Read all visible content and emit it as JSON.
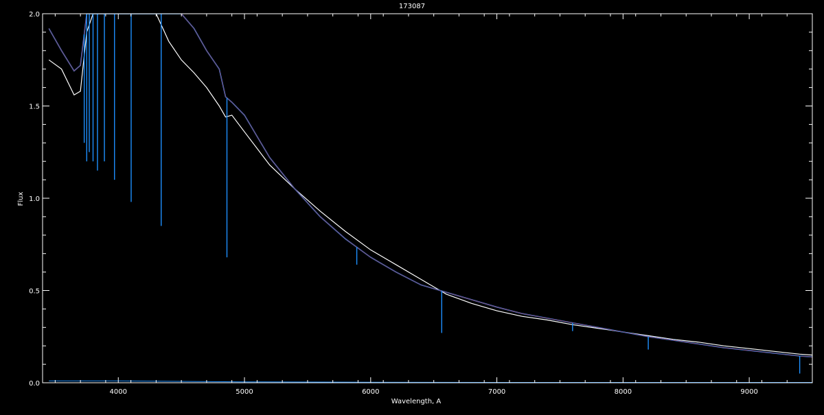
{
  "chart_data": {
    "type": "line",
    "title": "173087",
    "xlabel": "Wavelength, A",
    "ylabel": "Flux",
    "xlim": [
      3400,
      9500
    ],
    "ylim": [
      0,
      2
    ],
    "xticks": [
      4000,
      5000,
      6000,
      7000,
      8000,
      9000
    ],
    "yticks": [
      0.0,
      0.5,
      1.0,
      1.5,
      2.0
    ],
    "ytick_labels": [
      "0.0",
      "0.5",
      "1.0",
      "1.5",
      "2.0"
    ],
    "grid": false,
    "legend": "none",
    "colors": {
      "background": "#000000",
      "axes": "#ffffff",
      "observed": "#ffffff",
      "model": "#1e90ff",
      "fit": "#cc2020"
    },
    "series": [
      {
        "color_key": "observed",
        "x": [
          3450,
          3550,
          3650,
          3700,
          3750,
          3800,
          3900,
          4000,
          4100,
          4200,
          4300,
          4400,
          4500,
          4600,
          4700,
          4800,
          4850,
          4900,
          5000,
          5200,
          5400,
          5600,
          5800,
          6000,
          6200,
          6400,
          6600,
          6800,
          7000,
          7200,
          7400,
          7600,
          7800,
          8000,
          8200,
          8400,
          8600,
          8800,
          9000,
          9200,
          9400,
          9500
        ],
        "y": [
          1.75,
          1.7,
          1.56,
          1.58,
          1.9,
          2.0,
          2.0,
          2.0,
          2.0,
          2.0,
          2.0,
          1.85,
          1.75,
          1.68,
          1.6,
          1.5,
          1.44,
          1.45,
          1.36,
          1.18,
          1.05,
          0.93,
          0.82,
          0.72,
          0.64,
          0.56,
          0.48,
          0.43,
          0.39,
          0.36,
          0.34,
          0.315,
          0.295,
          0.275,
          0.255,
          0.235,
          0.22,
          0.2,
          0.185,
          0.17,
          0.155,
          0.15
        ]
      },
      {
        "color_key": "model",
        "x": [
          3450,
          3550,
          3650,
          3700,
          3750,
          3800,
          3900,
          4000,
          4100,
          4200,
          4300,
          4400,
          4500,
          4600,
          4700,
          4800,
          4850,
          4900,
          5000,
          5200,
          5400,
          5600,
          5800,
          6000,
          6200,
          6400,
          6600,
          6800,
          7000,
          7200,
          7400,
          7600,
          7800,
          8000,
          8200,
          8400,
          8600,
          8800,
          9000,
          9200,
          9400,
          9500
        ],
        "y": [
          1.92,
          1.8,
          1.69,
          1.72,
          2.0,
          2.0,
          2.0,
          2.0,
          2.0,
          2.0,
          2.0,
          2.0,
          2.0,
          1.92,
          1.8,
          1.7,
          1.55,
          1.52,
          1.45,
          1.22,
          1.05,
          0.9,
          0.78,
          0.68,
          0.6,
          0.53,
          0.49,
          0.45,
          0.41,
          0.375,
          0.35,
          0.325,
          0.3,
          0.275,
          0.25,
          0.23,
          0.21,
          0.19,
          0.175,
          0.16,
          0.145,
          0.14
        ]
      }
    ],
    "absorption_lines": [
      {
        "x": 3730,
        "depth_to": 1.3
      },
      {
        "x": 3750,
        "depth_to": 1.2
      },
      {
        "x": 3770,
        "depth_to": 1.25
      },
      {
        "x": 3800,
        "depth_to": 1.2
      },
      {
        "x": 3835,
        "depth_to": 1.15
      },
      {
        "x": 3890,
        "depth_to": 1.2
      },
      {
        "x": 3970,
        "depth_to": 1.1
      },
      {
        "x": 4102,
        "depth_to": 0.98
      },
      {
        "x": 4340,
        "depth_to": 0.85
      },
      {
        "x": 4861,
        "depth_to": 0.68
      },
      {
        "x": 5890,
        "depth_to": 0.64
      },
      {
        "x": 6563,
        "depth_to": 0.27
      },
      {
        "x": 7600,
        "depth_to": 0.28
      },
      {
        "x": 8200,
        "depth_to": 0.18
      },
      {
        "x": 9400,
        "depth_to": 0.05
      }
    ],
    "baseline_series": {
      "color_key": "model",
      "x": [
        3450,
        4000,
        5000,
        6000,
        7000,
        8000,
        9000,
        9500
      ],
      "y": [
        0.01,
        0.01,
        0.005,
        0.003,
        0.002,
        0.002,
        0.002,
        0.002
      ]
    }
  }
}
